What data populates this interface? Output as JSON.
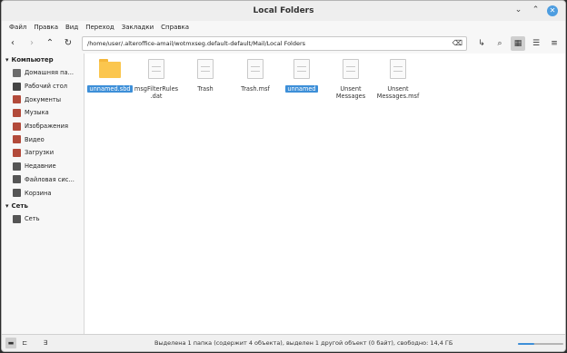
{
  "window": {
    "title": "Local Folders"
  },
  "menu": [
    "Файл",
    "Правка",
    "Вид",
    "Переход",
    "Закладки",
    "Справка"
  ],
  "path": {
    "value": "/home/user/.alteroffice-amail/wotmxseg.default-default/Mail/Local Folders"
  },
  "sidebar": {
    "computer_header": "Компьютер",
    "computer_items": [
      {
        "label": "Домашняя па...",
        "icon": "home-icon",
        "color": "#6b6b6b"
      },
      {
        "label": "Рабочий стол",
        "icon": "desktop-icon",
        "color": "#444444"
      },
      {
        "label": "Документы",
        "icon": "documents-icon",
        "color": "#b24a3a"
      },
      {
        "label": "Музыка",
        "icon": "music-icon",
        "color": "#b24a3a"
      },
      {
        "label": "Изображения",
        "icon": "pictures-icon",
        "color": "#b24a3a"
      },
      {
        "label": "Видео",
        "icon": "video-icon",
        "color": "#b24a3a"
      },
      {
        "label": "Загрузки",
        "icon": "downloads-icon",
        "color": "#b24a3a"
      },
      {
        "label": "Недавние",
        "icon": "recent-icon",
        "color": "#555555"
      },
      {
        "label": "Файловая сис...",
        "icon": "filesystem-icon",
        "color": "#555555"
      },
      {
        "label": "Корзина",
        "icon": "trash-icon",
        "color": "#555555"
      }
    ],
    "network_header": "Сеть",
    "network_items": [
      {
        "label": "Сеть",
        "icon": "network-icon",
        "color": "#555555"
      }
    ]
  },
  "files": [
    {
      "name": "unnamed.sbd",
      "type": "folder",
      "selected": true
    },
    {
      "name": "msgFilterRules\n.dat",
      "type": "file",
      "selected": false
    },
    {
      "name": "Trash",
      "type": "file",
      "selected": false
    },
    {
      "name": "Trash.msf",
      "type": "file",
      "selected": false
    },
    {
      "name": "unnamed",
      "type": "file",
      "selected": true
    },
    {
      "name": "Unsent\nMessages",
      "type": "file",
      "selected": false
    },
    {
      "name": "Unsent\nMessages.msf",
      "type": "file",
      "selected": false
    }
  ],
  "status": {
    "text": "Выделена 1 папка (содержит 4 объекта), выделен 1 другой объект (0 байт), свободно: 14,4 ГБ",
    "zoom_level": 0.35
  },
  "colors": {
    "accent": "#3d8fd8",
    "folder": "#fbc64e"
  }
}
